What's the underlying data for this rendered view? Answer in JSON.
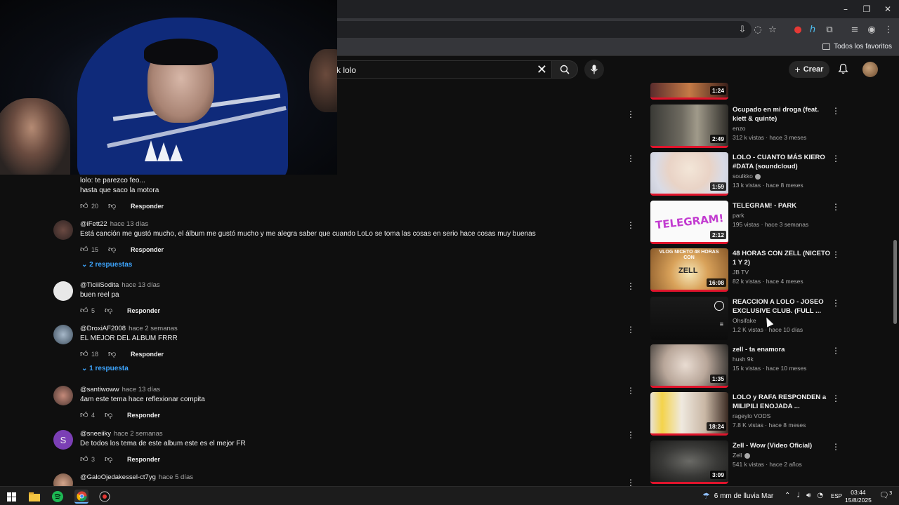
{
  "window": {
    "minimize": "–",
    "restore": "❐",
    "close": "✕"
  },
  "bookmarks": {
    "all_favorites": "Todos los favoritos"
  },
  "search": {
    "query": "k lolo",
    "clear": "✕"
  },
  "header": {
    "create_label": "Crear"
  },
  "comments": [
    {
      "lines": [
        "lolo: te parezco feo...",
        "hasta que saco la motora"
      ],
      "likes": "20",
      "reply": "Responder"
    },
    {
      "author": "@iFett22",
      "time": "hace 13 días",
      "text": "Está canción me gustó mucho, el álbum me gustó mucho y me alegra saber que cuando LoLo se toma las cosas en serio hace cosas muy buenas",
      "likes": "15",
      "reply": "Responder",
      "replies": "2 respuestas"
    },
    {
      "author": "@TiciiiSodita",
      "time": "hace 13 días",
      "text": "buen reel pa",
      "likes": "5",
      "reply": "Responder"
    },
    {
      "author": "@DroxiAF2008",
      "time": "hace 2 semanas",
      "text": "EL MEJOR DEL ALBUM FRRR",
      "likes": "18",
      "reply": "Responder",
      "replies": "1 respuesta"
    },
    {
      "author": "@santiwoww",
      "time": "hace 13 días",
      "text": "4am este tema hace reflexionar compita",
      "likes": "4",
      "reply": "Responder"
    },
    {
      "author": "@sneeiiky",
      "time": "hace 2 semanas",
      "text": "De todos los tema de este album este es el mejor FR",
      "likes": "3",
      "reply": "Responder",
      "avatar_letter": "S"
    },
    {
      "author": "@GaloOjedakessel-ct7yg",
      "time": "hace 5 días"
    }
  ],
  "recommended": [
    {
      "title": "",
      "duration": "1:24"
    },
    {
      "title": "Ocupado en mi droga (feat. kiett & quinte)",
      "channel": "enzo",
      "stats": "312 k vistas · hace 3 meses",
      "duration": "2:49"
    },
    {
      "title": "LOLO - CUANTO MÁS KIERO #DATA (soundcloud)",
      "channel": "soulkko",
      "stats": "13 k vistas · hace 8 meses",
      "duration": "1:59"
    },
    {
      "title": "TELEGRAM! - PARK",
      "channel": "park",
      "stats": "195 vistas · hace 3 semanas",
      "duration": "2:12",
      "thumb_text": "TELEGRAM!"
    },
    {
      "title": "48 HORAS CON ZELL (NICETO 1 Y 2)",
      "channel": "JB TV",
      "stats": "82 k vistas · hace 4 meses",
      "duration": "16:08",
      "thumb_text": "VLOG NICETO 48 HORAS CON",
      "thumb_text2": "ZELL"
    },
    {
      "title": "REACCION A LOLO - JOSEO EXCLUSIVE CLUB. (FULL ...",
      "channel": "Ohsifake",
      "stats": "1.2 K vistas · hace 10 días",
      "duration": ""
    },
    {
      "title": "zell - ta enamora",
      "channel": "hush 9k",
      "stats": "15 k vistas · hace 10 meses",
      "duration": "1:35"
    },
    {
      "title": "LOLO y RAFA RESPONDEN a MILIPILI ENOJADA ...",
      "channel": "rageylo VODS",
      "stats": "7.8 K vistas · hace 8 meses",
      "duration": "18:24"
    },
    {
      "title": "Zell - Wow (Video Oficial)",
      "channel": "Zell",
      "stats": "541 k vistas · hace 2 años",
      "duration": "3:09"
    }
  ],
  "taskbar": {
    "weather": "6 mm de lluvia Mar",
    "lang": "ESP",
    "time": "03:44",
    "date": "15/8/2025",
    "notif_count": "3"
  },
  "colors": {
    "background": "#0f0f0f",
    "accent_link": "#3ea6ff",
    "progress_red": "#e0142c"
  }
}
